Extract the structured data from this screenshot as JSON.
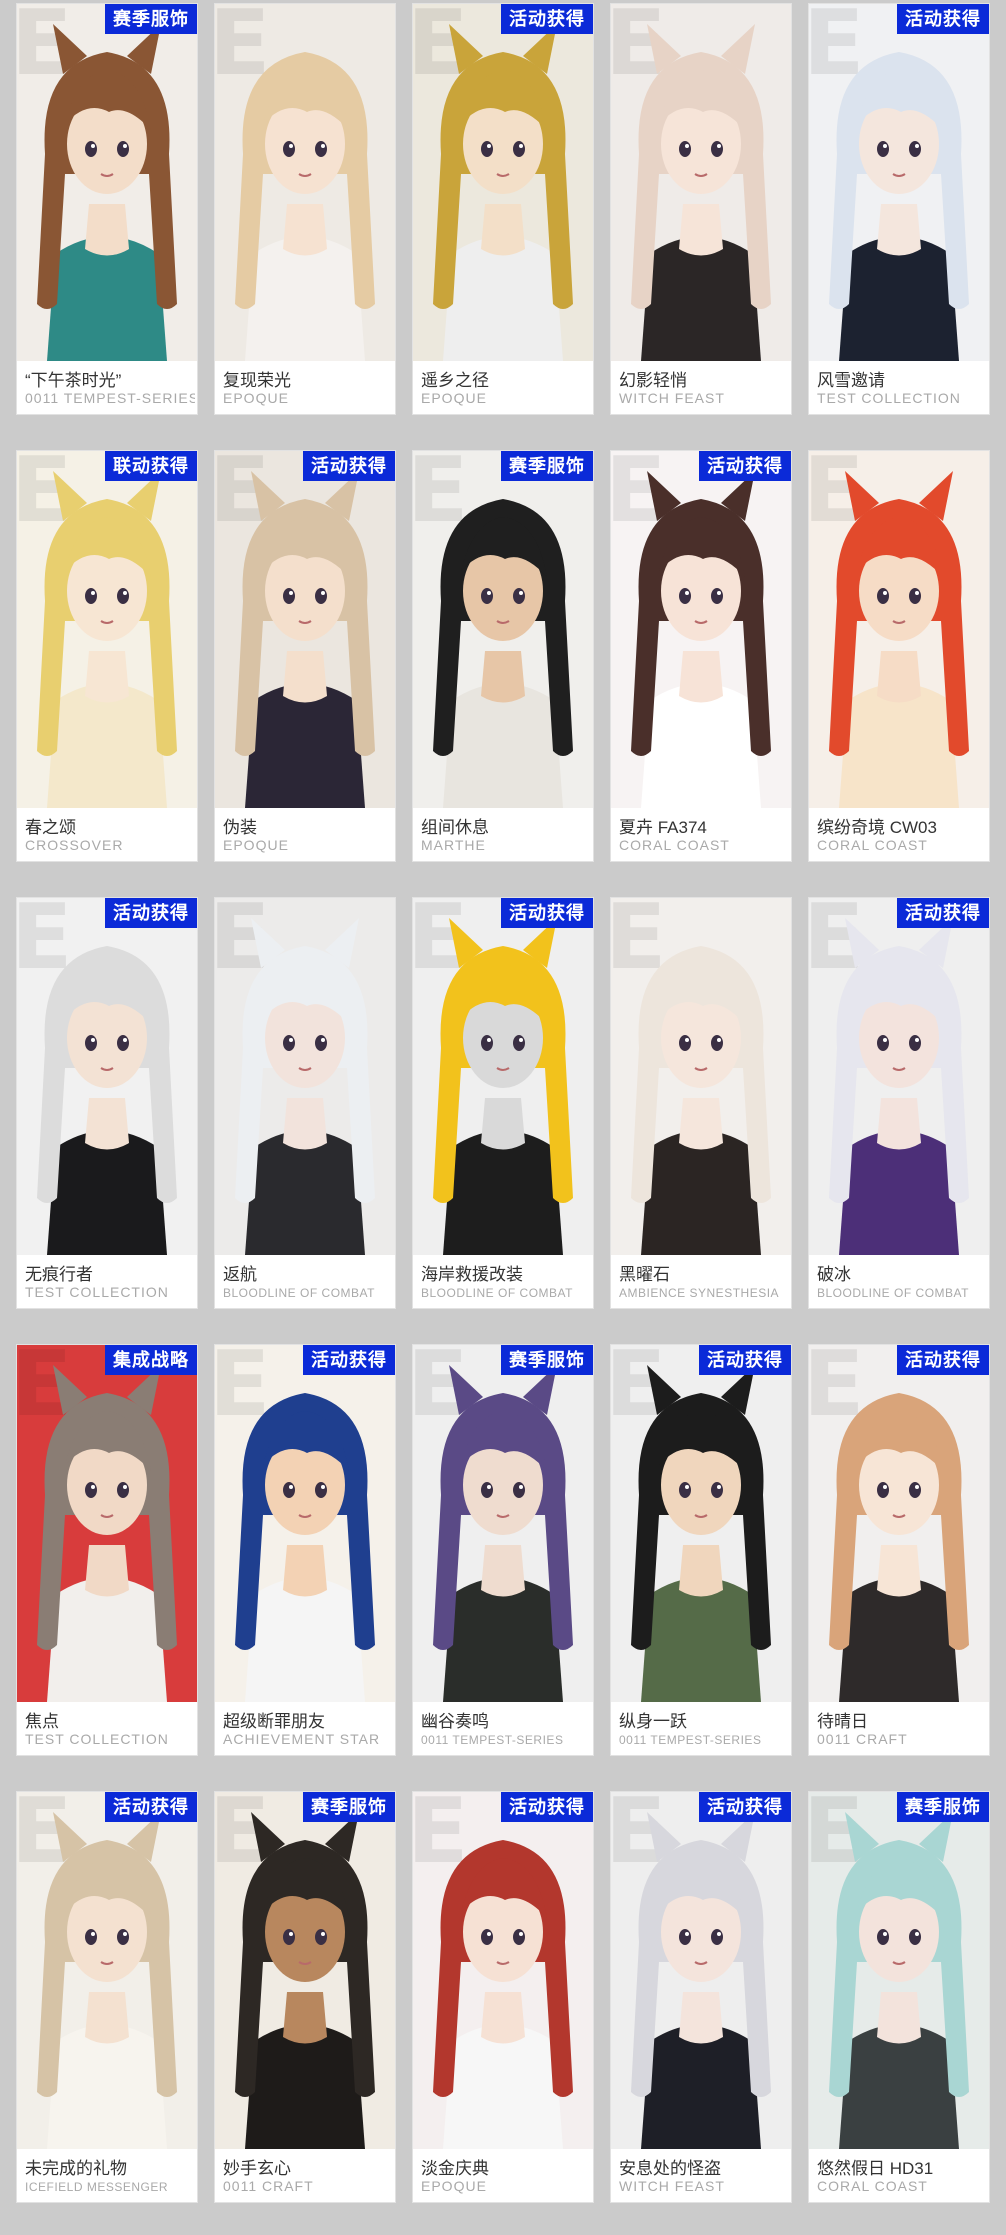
{
  "cards": [
    {
      "name": "“下午茶时光”",
      "series": "0011 TEMPEST-SERIES",
      "badge": "赛季服饰",
      "hair": "#8a5634",
      "bg": "#f1ede8",
      "cloth": "#2e8a86",
      "skin": "#f3ddc9"
    },
    {
      "name": "复现荣光",
      "series": "EPOQUE",
      "badge": "",
      "hair": "#e5cba3",
      "bg": "#eeeae4",
      "cloth": "#f4f1ee",
      "skin": "#f6e2d1"
    },
    {
      "name": "遥乡之径",
      "series": "EPOQUE",
      "badge": "活动获得",
      "hair": "#c9a43a",
      "bg": "#ece8dd",
      "cloth": "#eeeeee",
      "skin": "#f3dfc8"
    },
    {
      "name": "幻影轻悄",
      "series": "WITCH FEAST",
      "badge": "",
      "hair": "#e7d3c6",
      "bg": "#efebe8",
      "cloth": "#2b2626",
      "skin": "#f6e4d8"
    },
    {
      "name": "风雪邀请",
      "series": "TEST COLLECTION",
      "badge": "活动获得",
      "hair": "#dbe3ee",
      "bg": "#f0f1f3",
      "cloth": "#1c2230",
      "skin": "#f4e6dd"
    },
    {
      "name": "春之颂",
      "series": "CROSSOVER",
      "badge": "联动获得",
      "hair": "#e8cf6f",
      "bg": "#f5f1e6",
      "cloth": "#f4e8cb",
      "skin": "#f7e6d3"
    },
    {
      "name": "伪装",
      "series": "EPOQUE",
      "badge": "活动获得",
      "hair": "#d8c2a5",
      "bg": "#ebe6df",
      "cloth": "#2b2636",
      "skin": "#f4dfcc"
    },
    {
      "name": "组间休息",
      "series": "MARTHE",
      "badge": "赛季服饰",
      "hair": "#1f1f1f",
      "bg": "#f0efec",
      "cloth": "#e8e5df",
      "skin": "#e7c6a7"
    },
    {
      "name": "夏卉 FA374",
      "series": "CORAL COAST",
      "badge": "活动获得",
      "hair": "#4a2f2a",
      "bg": "#f7f3f3",
      "cloth": "#ffffff",
      "skin": "#f7e3d7"
    },
    {
      "name": "缤纷奇境 CW03",
      "series": "CORAL COAST",
      "badge": "",
      "hair": "#e24a2c",
      "bg": "#f6efe8",
      "cloth": "#f7e4c9",
      "skin": "#f6dcc6"
    },
    {
      "name": "无痕行者",
      "series": "TEST COLLECTION",
      "badge": "活动获得",
      "hair": "#dcdcdc",
      "bg": "#f1f1f1",
      "cloth": "#1a1a1c",
      "skin": "#f3e2d4"
    },
    {
      "name": "返航",
      "series": "BLOODLINE OF COMBAT",
      "badge": "",
      "hair": "#eceff2",
      "bg": "#ecebea",
      "cloth": "#2a2a2e",
      "skin": "#f2e3dc",
      "small": true
    },
    {
      "name": "海岸救援改装",
      "series": "BLOODLINE OF COMBAT",
      "badge": "活动获得",
      "hair": "#f2c21c",
      "bg": "#efefef",
      "cloth": "#1d1d1d",
      "skin": "#d9d9d9",
      "small": true
    },
    {
      "name": "黑曜石",
      "series": "AMBIENCE SYNESTHESIA",
      "badge": "",
      "hair": "#ede5dc",
      "bg": "#f2efec",
      "cloth": "#2b2523",
      "skin": "#f5e6dc",
      "small": true
    },
    {
      "name": "破冰",
      "series": "BLOODLINE OF COMBAT",
      "badge": "活动获得",
      "hair": "#e6e6ee",
      "bg": "#efefef",
      "cloth": "#4c2f78",
      "skin": "#f3e3dd",
      "small": true
    },
    {
      "name": "焦点",
      "series": "TEST COLLECTION",
      "badge": "集成战略",
      "hair": "#8a7d74",
      "bg": "#d83c3c",
      "cloth": "#f2efec",
      "skin": "#f1d9c6"
    },
    {
      "name": "超级断罪朋友",
      "series": "ACHIEVEMENT STAR",
      "badge": "活动获得",
      "hair": "#1f3f8f",
      "bg": "#f5f1ea",
      "cloth": "#f5f5f5",
      "skin": "#f3d2b4"
    },
    {
      "name": "幽谷奏鸣",
      "series": "0011 TEMPEST-SERIES",
      "badge": "赛季服饰",
      "hair": "#5a4a86",
      "bg": "#efefef",
      "cloth": "#2a2d2a",
      "skin": "#efdccf",
      "small": true
    },
    {
      "name": "纵身一跃",
      "series": "0011 TEMPEST-SERIES",
      "badge": "活动获得",
      "hair": "#1c1c1c",
      "bg": "#efefef",
      "cloth": "#556b48",
      "skin": "#f0d6bd",
      "small": true
    },
    {
      "name": "待晴日",
      "series": "0011 CRAFT",
      "badge": "活动获得",
      "hair": "#d9a47a",
      "bg": "#f1efee",
      "cloth": "#2e2a2a",
      "skin": "#f7e5d6"
    },
    {
      "name": "未完成的礼物",
      "series": "ICEFIELD MESSENGER",
      "badge": "活动获得",
      "hair": "#d6c3a6",
      "bg": "#f2efe9",
      "cloth": "#f7f4ee",
      "skin": "#f4e1d0",
      "small": true
    },
    {
      "name": "妙手玄心",
      "series": "0011 CRAFT",
      "badge": "赛季服饰",
      "hair": "#2d2824",
      "bg": "#f0ebe3",
      "cloth": "#1e1b19",
      "skin": "#b8875e"
    },
    {
      "name": "淡金庆典",
      "series": "EPOQUE",
      "badge": "活动获得",
      "hair": "#b3372d",
      "bg": "#f4efef",
      "cloth": "#f7f7f7",
      "skin": "#f6e1d4"
    },
    {
      "name": "安息处的怪盗",
      "series": "WITCH FEAST",
      "badge": "活动获得",
      "hair": "#d7d7dd",
      "bg": "#eeeeee",
      "cloth": "#1e1f27",
      "skin": "#f4e4dc"
    },
    {
      "name": "悠然假日 HD31",
      "series": "CORAL COAST",
      "badge": "赛季服饰",
      "hair": "#a9d6d3",
      "bg": "#e6ebe9",
      "cloth": "#3a4041",
      "skin": "#f3e3dc"
    }
  ]
}
